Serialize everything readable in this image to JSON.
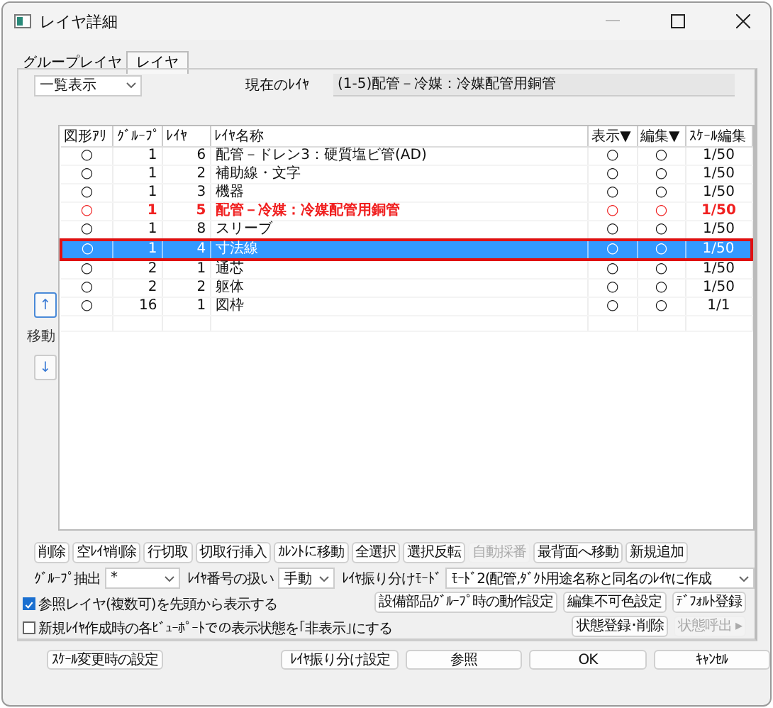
{
  "window": {
    "title": "レイヤ詳細"
  },
  "tabs": [
    {
      "label": "グループレイヤ",
      "selected": false
    },
    {
      "label": "レイヤ",
      "selected": true
    }
  ],
  "view_mode": {
    "value": "一覧表示"
  },
  "current_layer": {
    "label": "現在のﾚｲﾔ",
    "value": "(1-5)配管－冷媒：冷媒配管用銅管"
  },
  "move": {
    "label": "移動",
    "up": "↑",
    "down": "↓"
  },
  "table": {
    "columns": [
      "図形ｱﾘ",
      "ｸﾞﾙｰﾌﾟ",
      "ﾚｲﾔ",
      "ﾚｲﾔ名称",
      "表示▼",
      "編集▼",
      "ｽｹｰﾙ編集"
    ],
    "rows": [
      {
        "cells": [
          "○",
          "1",
          "6",
          "配管－ドレン3：硬質塩ビ管(AD)",
          "○",
          "○",
          "1/50"
        ],
        "current": false,
        "selected": false
      },
      {
        "cells": [
          "○",
          "1",
          "2",
          "補助線・文字",
          "○",
          "○",
          "1/50"
        ],
        "current": false,
        "selected": false
      },
      {
        "cells": [
          "○",
          "1",
          "3",
          "機器",
          "○",
          "○",
          "1/50"
        ],
        "current": false,
        "selected": false
      },
      {
        "cells": [
          "○",
          "1",
          "5",
          "配管－冷媒：冷媒配管用銅管",
          "○",
          "○",
          "1/50"
        ],
        "current": true,
        "selected": false
      },
      {
        "cells": [
          "○",
          "1",
          "8",
          "スリーブ",
          "○",
          "○",
          "1/50"
        ],
        "current": false,
        "selected": false
      },
      {
        "cells": [
          "○",
          "1",
          "4",
          "寸法線",
          "○",
          "○",
          "1/50"
        ],
        "current": false,
        "selected": true
      },
      {
        "cells": [
          "○",
          "2",
          "1",
          "通芯",
          "○",
          "○",
          "1/50"
        ],
        "current": false,
        "selected": false
      },
      {
        "cells": [
          "○",
          "2",
          "2",
          "躯体",
          "○",
          "○",
          "1/50"
        ],
        "current": false,
        "selected": false
      },
      {
        "cells": [
          "○",
          "16",
          "1",
          "図枠",
          "○",
          "○",
          "1/1"
        ],
        "current": false,
        "selected": false
      }
    ]
  },
  "action_buttons": [
    {
      "label": "削除",
      "disabled": false
    },
    {
      "label": "空ﾚｲﾔ削除",
      "disabled": false
    },
    {
      "label": "行切取",
      "disabled": false
    },
    {
      "label": "切取行挿入",
      "disabled": false
    },
    {
      "label": "ｶﾚﾝﾄに移動",
      "disabled": false
    },
    {
      "label": "全選択",
      "disabled": false
    },
    {
      "label": "選択反転",
      "disabled": false
    },
    {
      "label": "自動採番",
      "disabled": true
    },
    {
      "label": "最背面へ移動",
      "disabled": false
    },
    {
      "label": "新規追加",
      "disabled": false
    }
  ],
  "filters": [
    {
      "label": "ｸﾞﾙｰﾌﾟ抽出",
      "value": "*"
    },
    {
      "label": "ﾚｲﾔ番号の扱い",
      "value": "手動"
    },
    {
      "label": "ﾚｲﾔ振り分けﾓｰﾄﾞ",
      "value": "ﾓｰﾄﾞ2(配管,ﾀﾞｸﾄ用途名称と同名のﾚｲﾔに作成"
    }
  ],
  "checkboxes": [
    {
      "label": "参照レイヤ(複数可)を先頭から表示する",
      "checked": true
    },
    {
      "label": "新規ﾚｲﾔ作成時の各ﾋﾞｭｰﾎﾟｰﾄでの表示状態を｢非表示｣にする",
      "checked": false
    }
  ],
  "option_buttons": [
    {
      "label": "設備部品ｸﾞﾙｰﾌﾟ時の動作設定",
      "disabled": false
    },
    {
      "label": "編集不可色設定",
      "disabled": false
    },
    {
      "label": "ﾃﾞﾌｫﾙﾄ登録",
      "disabled": false
    },
    {
      "label": "状態登録･削除",
      "disabled": false
    },
    {
      "label": "状態呼出 ▸",
      "disabled": true
    }
  ],
  "footer_buttons": [
    "ｽｹｰﾙ変更時の設定",
    "ﾚｲﾔ振り分け設定",
    "参照",
    "OK",
    "ｷｬﾝｾﾙ"
  ]
}
